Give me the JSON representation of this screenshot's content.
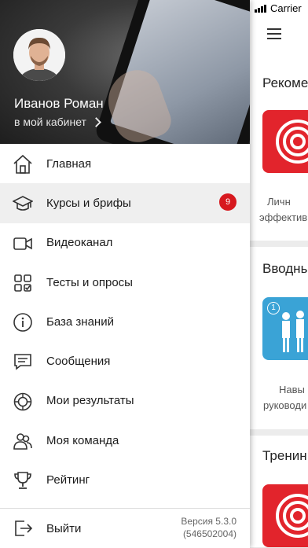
{
  "status_bar": {
    "carrier": "Carrier"
  },
  "background_screen": {
    "section1_title": "Рекоме",
    "section1_caption_line1": "Личн",
    "section1_caption_line2": "эффектив",
    "section2_title": "Вводны",
    "section2_caption_line1": "Навы",
    "section2_caption_line2": "руководи",
    "section2_tile_badge": "1",
    "section3_title": "Тренин",
    "accent_color": "#e2242c"
  },
  "drawer": {
    "user_name": "Иванов Роман",
    "cabinet_link": "в мой кабинет",
    "menu": [
      {
        "label": "Главная",
        "icon": "home-icon"
      },
      {
        "label": "Курсы и брифы",
        "icon": "graduation-cap-icon",
        "badge": "9",
        "active": true
      },
      {
        "label": "Видеоканал",
        "icon": "video-camera-icon"
      },
      {
        "label": "Тесты и опросы",
        "icon": "tests-grid-icon"
      },
      {
        "label": "База знаний",
        "icon": "info-circle-icon"
      },
      {
        "label": "Сообщения",
        "icon": "message-icon"
      },
      {
        "label": "Мои результаты",
        "icon": "results-ring-icon"
      },
      {
        "label": "Моя команда",
        "icon": "team-icon"
      },
      {
        "label": "Рейтинг",
        "icon": "trophy-icon"
      }
    ],
    "logout_label": "Выйти",
    "version_line1": "Версия 5.3.0",
    "version_line2": "(546502004)",
    "badge_color": "#d7191f"
  }
}
